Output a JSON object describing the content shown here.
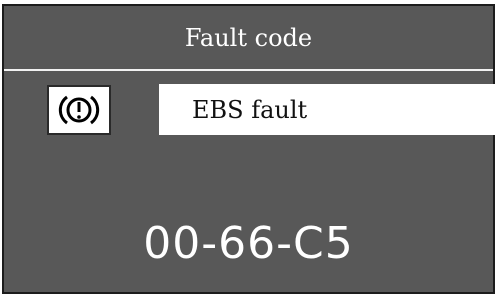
{
  "header": {
    "title": "Fault code"
  },
  "fault": {
    "icon": "brake-warning-icon",
    "label": "EBS fault",
    "code": "00-66-C5"
  },
  "colors": {
    "screen_bg": "#585858",
    "text": "#ffffff",
    "field_bg": "#ffffff"
  }
}
